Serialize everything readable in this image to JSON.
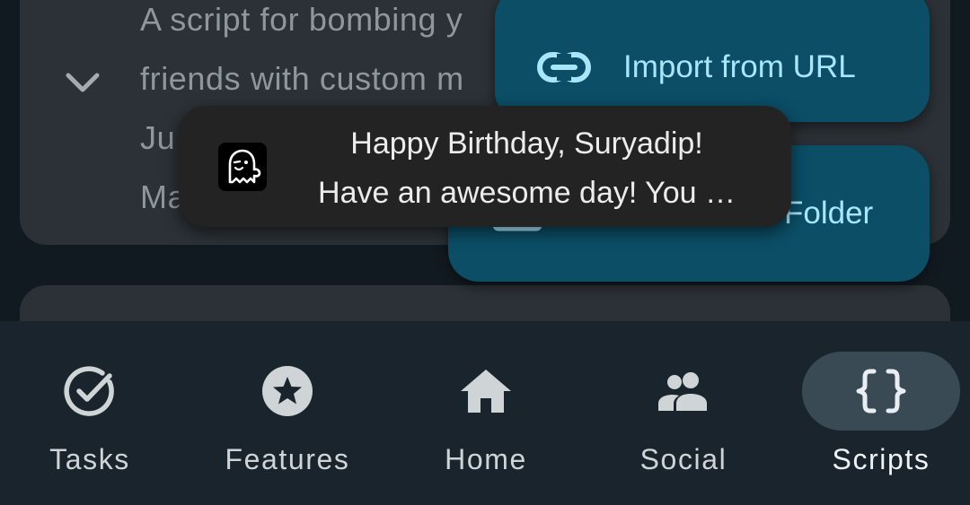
{
  "background_card": {
    "lines": [
      "A script for bombing y",
      "friends with custom m",
      "Ju",
      "Ma"
    ]
  },
  "fab_menu": {
    "import_url_label": "Import from URL",
    "import_folder_label": "Folder"
  },
  "toast": {
    "line1": "Happy Birthday, Suryadip!",
    "line2": "Have an awesome day! You …"
  },
  "bottom_nav": {
    "items": [
      {
        "label": "Tasks",
        "icon": "check-circle-icon",
        "selected": false
      },
      {
        "label": "Features",
        "icon": "star-circle-icon",
        "selected": false
      },
      {
        "label": "Home",
        "icon": "home-icon",
        "selected": false
      },
      {
        "label": "Social",
        "icon": "people-icon",
        "selected": false
      },
      {
        "label": "Scripts",
        "icon": "code-braces-icon",
        "selected": true
      }
    ]
  },
  "colors": {
    "fab_background": "#0b4e66",
    "fab_foreground": "#a8e7fb",
    "nav_background": "#1a242c",
    "nav_selected_indicator": "#3a4a55",
    "toast_background": "#232323"
  }
}
